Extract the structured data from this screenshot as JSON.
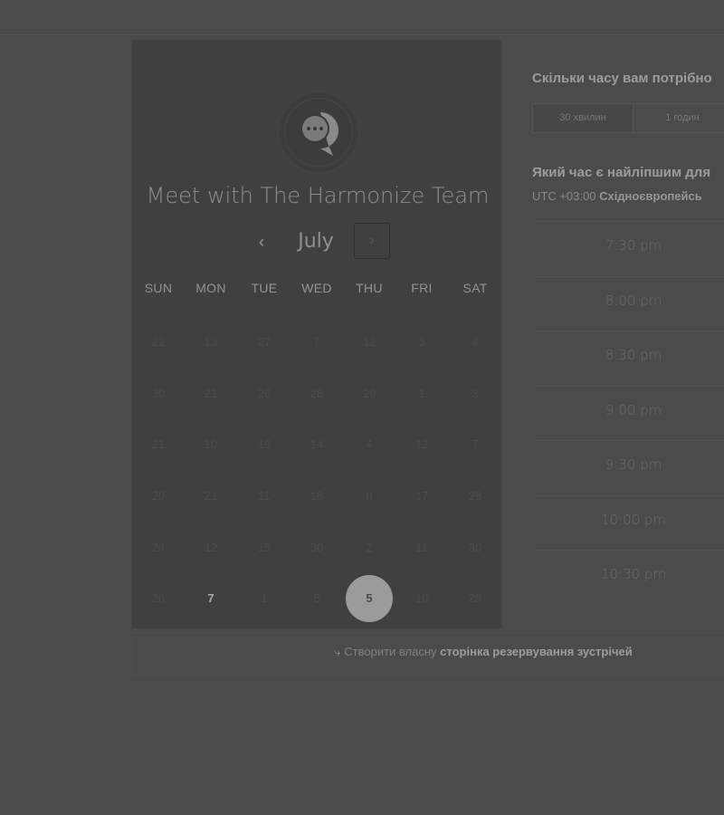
{
  "calendar": {
    "title": "Meet with The Harmonize Team",
    "month": "July",
    "prev_icon": "‹",
    "next_icon": "›",
    "weekdays": [
      "SUN",
      "MON",
      "TUE",
      "WED",
      "THU",
      "FRI",
      "SAT"
    ],
    "weeks": [
      [
        "22",
        "13",
        "27",
        "7",
        "12",
        "3",
        "4"
      ],
      [
        "30",
        "21",
        "26",
        "28",
        "29",
        "1",
        "3"
      ],
      [
        "21",
        "10",
        "19",
        "14",
        "4",
        "12",
        "7"
      ],
      [
        "20",
        "21",
        "11",
        "16",
        "8",
        "17",
        "26"
      ],
      [
        "24",
        "12",
        "15",
        "30",
        "2",
        "11",
        "30"
      ],
      [
        "26",
        "7",
        "1",
        "5",
        "5",
        "10",
        "28"
      ]
    ],
    "selected_day": "5"
  },
  "duration": {
    "question": "Скільки часу вам потрібно",
    "options": [
      "30 хвилин",
      "1 годин"
    ]
  },
  "time": {
    "question": "Який час є найліпшим для",
    "tz_offset": "UTC +03:00",
    "tz_name": "Східноєвропейсь",
    "slots": [
      "7:30 pm",
      "8:00 pm",
      "8:30 pm",
      "9:00 pm",
      "9:30 pm",
      "10:00 pm",
      "10:30 pm"
    ]
  },
  "footer": {
    "prefix": "Створити власну",
    "bold": "сторінка резервування зустрічей"
  },
  "colors": {
    "background": "#4b4b4b",
    "card": "#404040",
    "selected": "#9b9b9b"
  }
}
